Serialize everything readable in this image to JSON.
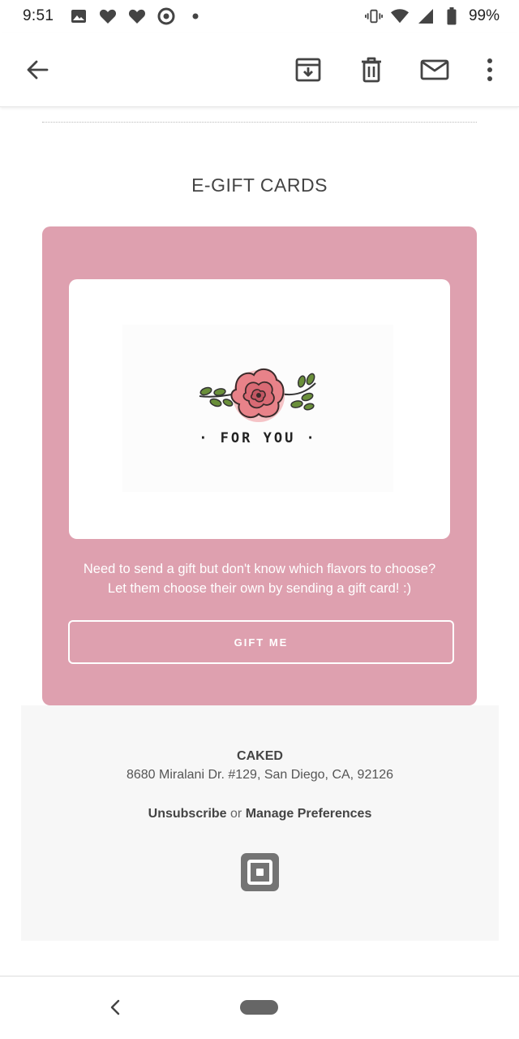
{
  "status_bar": {
    "time": "9:51",
    "battery_percent": "99%",
    "left_icons": [
      "image-icon",
      "heart-icon",
      "heart-icon",
      "target-icon",
      "dot-icon"
    ],
    "right_icons": [
      "vibrate-icon",
      "wifi-icon",
      "signal-icon",
      "battery-icon"
    ]
  },
  "app_bar": {
    "icons": [
      "back-arrow-icon",
      "archive-icon",
      "delete-icon",
      "mark-unread-icon",
      "more-vert-icon"
    ]
  },
  "email": {
    "section_title": "E-GIFT CARDS",
    "card_caption": "· FOR YOU ·",
    "gift_text_line1": "Need to send a gift but don't know which flavors to choose?",
    "gift_text_line2": "Let them choose their own by sending a gift card! :)",
    "gift_button_label": "GIFT ME",
    "panel_color": "#dea0af"
  },
  "footer": {
    "company": "CAKED",
    "address": "8680 Miralani Dr. #129, San Diego, CA, 92126",
    "unsubscribe_label": "Unsubscribe",
    "or_text": "or",
    "manage_label": "Manage Preferences"
  }
}
